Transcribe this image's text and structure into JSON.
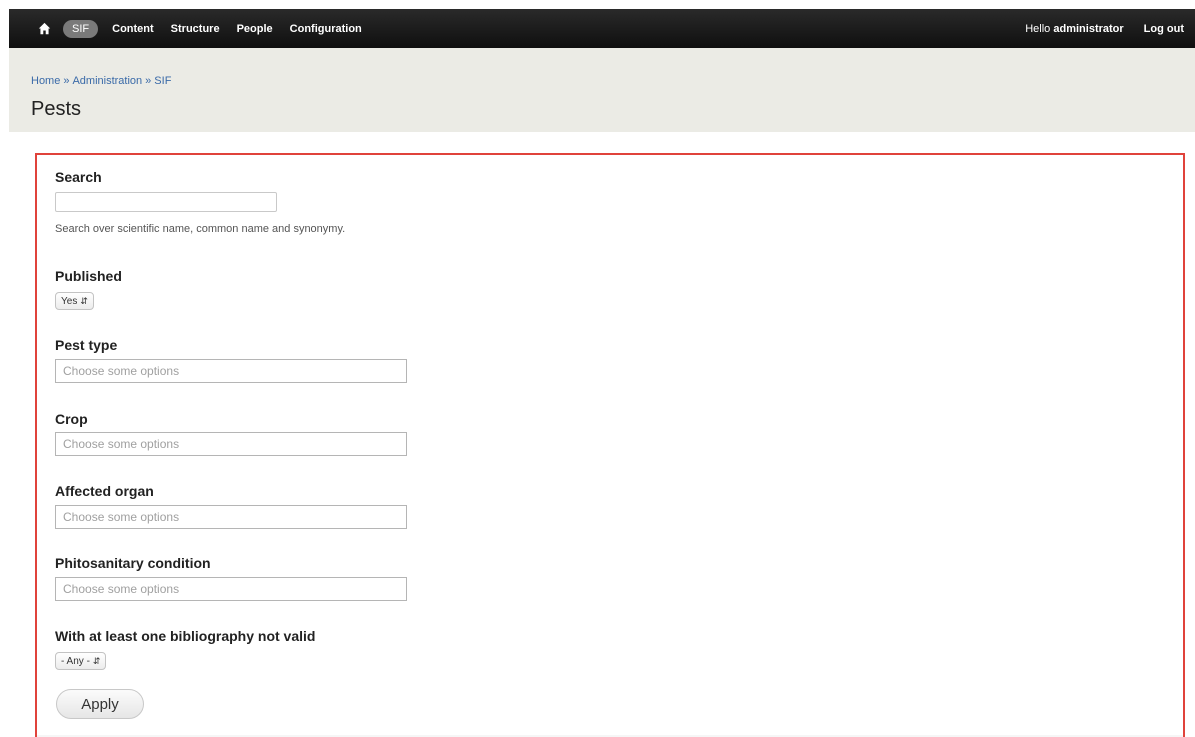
{
  "toolbar": {
    "home_icon": "home-icon",
    "pill_label": "SIF",
    "menu": [
      {
        "label": "Content"
      },
      {
        "label": "Structure"
      },
      {
        "label": "People"
      },
      {
        "label": "Configuration"
      }
    ],
    "greeting": "Hello",
    "username": "administrator",
    "logout_label": "Log out"
  },
  "header": {
    "breadcrumb": [
      {
        "label": "Home"
      },
      {
        "label": "Administration"
      },
      {
        "label": "SIF"
      }
    ],
    "separator": "»",
    "title": "Pests"
  },
  "form": {
    "search": {
      "label": "Search",
      "value": "",
      "help": "Search over scientific name, common name and synonymy."
    },
    "published": {
      "label": "Published",
      "selected": "Yes"
    },
    "pest_type": {
      "label": "Pest type",
      "placeholder": "Choose some options"
    },
    "crop": {
      "label": "Crop",
      "placeholder": "Choose some options"
    },
    "affected_organ": {
      "label": "Affected organ",
      "placeholder": "Choose some options"
    },
    "phitosanitary": {
      "label": "Phitosanitary condition",
      "placeholder": "Choose some options"
    },
    "bibliography": {
      "label": "With at least one bibliography not valid",
      "selected": "- Any -"
    },
    "apply_label": "Apply"
  },
  "colors": {
    "toolbar_bg": "#1a1a1a",
    "header_bg": "#ebebe5",
    "form_border": "#e0433b",
    "link": "#3a6aa8"
  }
}
